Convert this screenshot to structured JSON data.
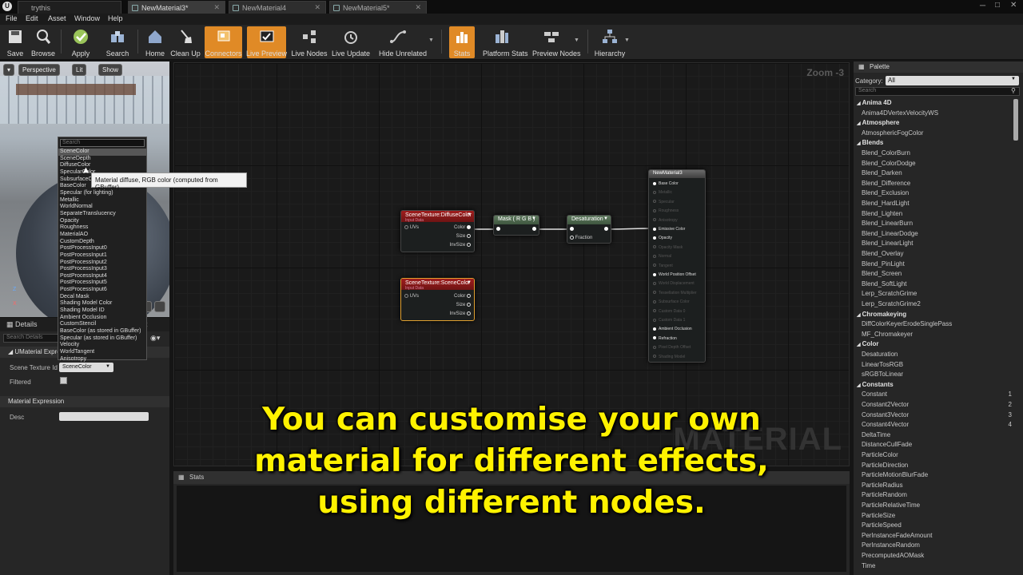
{
  "window": {
    "app_tab": "trythis",
    "tabs": [
      {
        "label": "NewMaterial3*",
        "active": true
      },
      {
        "label": "NewMaterial4",
        "active": false
      },
      {
        "label": "NewMaterial5*",
        "active": false
      }
    ]
  },
  "menu": [
    "File",
    "Edit",
    "Asset",
    "Window",
    "Help"
  ],
  "toolbar": [
    {
      "label": "Save",
      "icon": "save-icon"
    },
    {
      "label": "Browse",
      "icon": "browse-icon"
    },
    {
      "label": "Apply",
      "icon": "apply-icon"
    },
    {
      "label": "Search",
      "icon": "search-icon"
    },
    {
      "label": "Home",
      "icon": "home-icon"
    },
    {
      "label": "Clean Up",
      "icon": "clean-up-icon"
    },
    {
      "label": "Connectors",
      "icon": "connectors-icon",
      "active": true
    },
    {
      "label": "Live Preview",
      "icon": "live-preview-icon",
      "active": true
    },
    {
      "label": "Live Nodes",
      "icon": "live-nodes-icon"
    },
    {
      "label": "Live Update",
      "icon": "live-update-icon"
    },
    {
      "label": "Hide Unrelated",
      "icon": "hide-unrelated-icon"
    },
    {
      "label": "Stats",
      "icon": "stats-icon",
      "active": true
    },
    {
      "label": "Platform Stats",
      "icon": "platform-stats-icon"
    },
    {
      "label": "Preview Nodes",
      "icon": "preview-nodes-icon"
    },
    {
      "label": "Hierarchy",
      "icon": "hierarchy-icon"
    }
  ],
  "viewport": {
    "perspective": "Perspective",
    "lit": "Lit",
    "show": "Show"
  },
  "dropdown": {
    "placeholder": "Search",
    "options": [
      "SceneColor",
      "SceneDepth",
      "DiffuseColor",
      "SpecularColor",
      "SubsurfaceColor",
      "BaseColor",
      "Specular (for lighting)",
      "Metallic",
      "WorldNormal",
      "SeparateTranslucency",
      "Opacity",
      "Roughness",
      "MaterialAO",
      "CustomDepth",
      "PostProcessInput0",
      "PostProcessInput1",
      "PostProcessInput2",
      "PostProcessInput3",
      "PostProcessInput4",
      "PostProcessInput5",
      "PostProcessInput6",
      "Decal Mask",
      "Shading Model Color",
      "Shading Model ID",
      "Ambient Occlusion",
      "CustomStencil",
      "BaseColor (as stored in GBuffer)",
      "Specular (as stored in GBuffer)",
      "Velocity",
      "WorldTangent",
      "Anisotropy"
    ],
    "tooltip": "Material diffuse, RGB color (computed from GBuffer)"
  },
  "details": {
    "tab": "Details",
    "search_placeholder": "Search Details",
    "section1": "UMaterial Expre",
    "scene_texture_label": "Scene Texture Id",
    "scene_texture_value": "SceneColor",
    "filtered_label": "Filtered",
    "section2": "Material Expression",
    "desc_label": "Desc"
  },
  "graph": {
    "zoom": "Zoom -3",
    "watermark": "MATERIAL",
    "nodes": {
      "scene_texture_diffuse": {
        "title": "SceneTexture:DiffuseColor",
        "sub": "Input Data",
        "in": "UVs",
        "outs": [
          "Color",
          "Size",
          "InvSize"
        ]
      },
      "mask": {
        "title": "Mask ( R G B )"
      },
      "desaturation": {
        "title": "Desaturation",
        "in": "Fraction"
      },
      "scene_texture_color": {
        "title": "SceneTexture:SceneColor",
        "sub": "Input Data",
        "in": "UVs",
        "outs": [
          "Color",
          "Size",
          "InvSize"
        ]
      },
      "result": {
        "title": "NewMaterial3",
        "pins": [
          {
            "label": "Base Color",
            "active": true
          },
          {
            "label": "Metallic",
            "active": false
          },
          {
            "label": "Specular",
            "active": false
          },
          {
            "label": "Roughness",
            "active": false
          },
          {
            "label": "Anisotropy",
            "active": false
          },
          {
            "label": "Emissive Color",
            "active": true
          },
          {
            "label": "Opacity",
            "active": true
          },
          {
            "label": "Opacity Mask",
            "active": false
          },
          {
            "label": "Normal",
            "active": false
          },
          {
            "label": "Tangent",
            "active": false
          },
          {
            "label": "World Position Offset",
            "active": true
          },
          {
            "label": "World Displacement",
            "active": false
          },
          {
            "label": "Tessellation Multiplier",
            "active": false
          },
          {
            "label": "Subsurface Color",
            "active": false
          },
          {
            "label": "Custom Data 0",
            "active": false
          },
          {
            "label": "Custom Data 1",
            "active": false
          },
          {
            "label": "Ambient Occlusion",
            "active": true
          },
          {
            "label": "Refraction",
            "active": true
          },
          {
            "label": "Pixel Depth Offset",
            "active": false
          },
          {
            "label": "Shading Model",
            "active": false
          }
        ]
      }
    }
  },
  "stats": {
    "tab": "Stats"
  },
  "palette": {
    "tab": "Palette",
    "category_label": "Category:",
    "category_value": "All",
    "search_placeholder": "Search",
    "entries": [
      {
        "t": "cat",
        "label": "Anima 4D"
      },
      {
        "t": "item",
        "label": "Anima4DVertexVelocityWS"
      },
      {
        "t": "cat",
        "label": "Atmosphere"
      },
      {
        "t": "item",
        "label": "AtmosphericFogColor"
      },
      {
        "t": "cat",
        "label": "Blends"
      },
      {
        "t": "item",
        "label": "Blend_ColorBurn"
      },
      {
        "t": "item",
        "label": "Blend_ColorDodge"
      },
      {
        "t": "item",
        "label": "Blend_Darken"
      },
      {
        "t": "item",
        "label": "Blend_Difference"
      },
      {
        "t": "item",
        "label": "Blend_Exclusion"
      },
      {
        "t": "item",
        "label": "Blend_HardLight"
      },
      {
        "t": "item",
        "label": "Blend_Lighten"
      },
      {
        "t": "item",
        "label": "Blend_LinearBurn"
      },
      {
        "t": "item",
        "label": "Blend_LinearDodge"
      },
      {
        "t": "item",
        "label": "Blend_LinearLight"
      },
      {
        "t": "item",
        "label": "Blend_Overlay"
      },
      {
        "t": "item",
        "label": "Blend_PinLight"
      },
      {
        "t": "item",
        "label": "Blend_Screen"
      },
      {
        "t": "item",
        "label": "Blend_SoftLight"
      },
      {
        "t": "item",
        "label": "Lerp_ScratchGrime"
      },
      {
        "t": "item",
        "label": "Lerp_ScratchGrime2"
      },
      {
        "t": "cat",
        "label": "Chromakeying"
      },
      {
        "t": "item",
        "label": "DiffColorKeyerErodeSinglePass"
      },
      {
        "t": "item",
        "label": "MF_Chromakeyer"
      },
      {
        "t": "cat",
        "label": "Color"
      },
      {
        "t": "item",
        "label": "Desaturation"
      },
      {
        "t": "item",
        "label": "LinearTosRGB"
      },
      {
        "t": "item",
        "label": "sRGBToLinear"
      },
      {
        "t": "cat",
        "label": "Constants"
      },
      {
        "t": "item",
        "label": "Constant",
        "num": "1"
      },
      {
        "t": "item",
        "label": "Constant2Vector",
        "num": "2"
      },
      {
        "t": "item",
        "label": "Constant3Vector",
        "num": "3"
      },
      {
        "t": "item",
        "label": "Constant4Vector",
        "num": "4"
      },
      {
        "t": "item",
        "label": "DeltaTime"
      },
      {
        "t": "item",
        "label": "DistanceCullFade"
      },
      {
        "t": "item",
        "label": "ParticleColor"
      },
      {
        "t": "item",
        "label": "ParticleDirection"
      },
      {
        "t": "item",
        "label": "ParticleMotionBlurFade"
      },
      {
        "t": "item",
        "label": "ParticleRadius"
      },
      {
        "t": "item",
        "label": "ParticleRandom"
      },
      {
        "t": "item",
        "label": "ParticleRelativeTime"
      },
      {
        "t": "item",
        "label": "ParticleSize"
      },
      {
        "t": "item",
        "label": "ParticleSpeed"
      },
      {
        "t": "item",
        "label": "PerInstanceFadeAmount"
      },
      {
        "t": "item",
        "label": "PerInstanceRandom"
      },
      {
        "t": "item",
        "label": "PrecomputedAOMask"
      },
      {
        "t": "item",
        "label": "Time"
      }
    ]
  },
  "subtitle": [
    "You can customise your own",
    "material for different effects,",
    "using different nodes."
  ],
  "colors": {
    "accent": "#e08a26",
    "scene_texture_header": "#8b1a1a",
    "math_header": "#4f6b4f",
    "subtitle": "#fff200"
  }
}
